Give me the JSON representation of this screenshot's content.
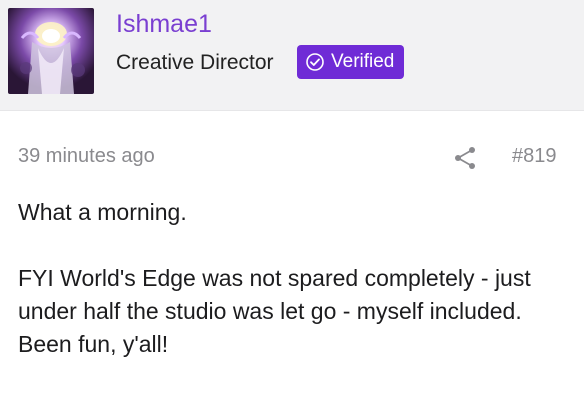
{
  "author": {
    "name": "Ishmae1",
    "title": "Creative Director",
    "badge": "Verified"
  },
  "post": {
    "time": "39 minutes ago",
    "number": "#819",
    "paragraphs": [
      "What a morning.",
      "FYI World's Edge was not spared completely - just under half the studio was let go - myself included. Been fun, y'all!"
    ]
  },
  "icons": {
    "share": "share-icon",
    "verified": "check-circle-icon"
  },
  "colors": {
    "author_name": "#7a3fd1",
    "badge_bg": "#6f2bd6",
    "meta_text": "#8a8a8e",
    "header_bg": "#f2f2f3"
  }
}
